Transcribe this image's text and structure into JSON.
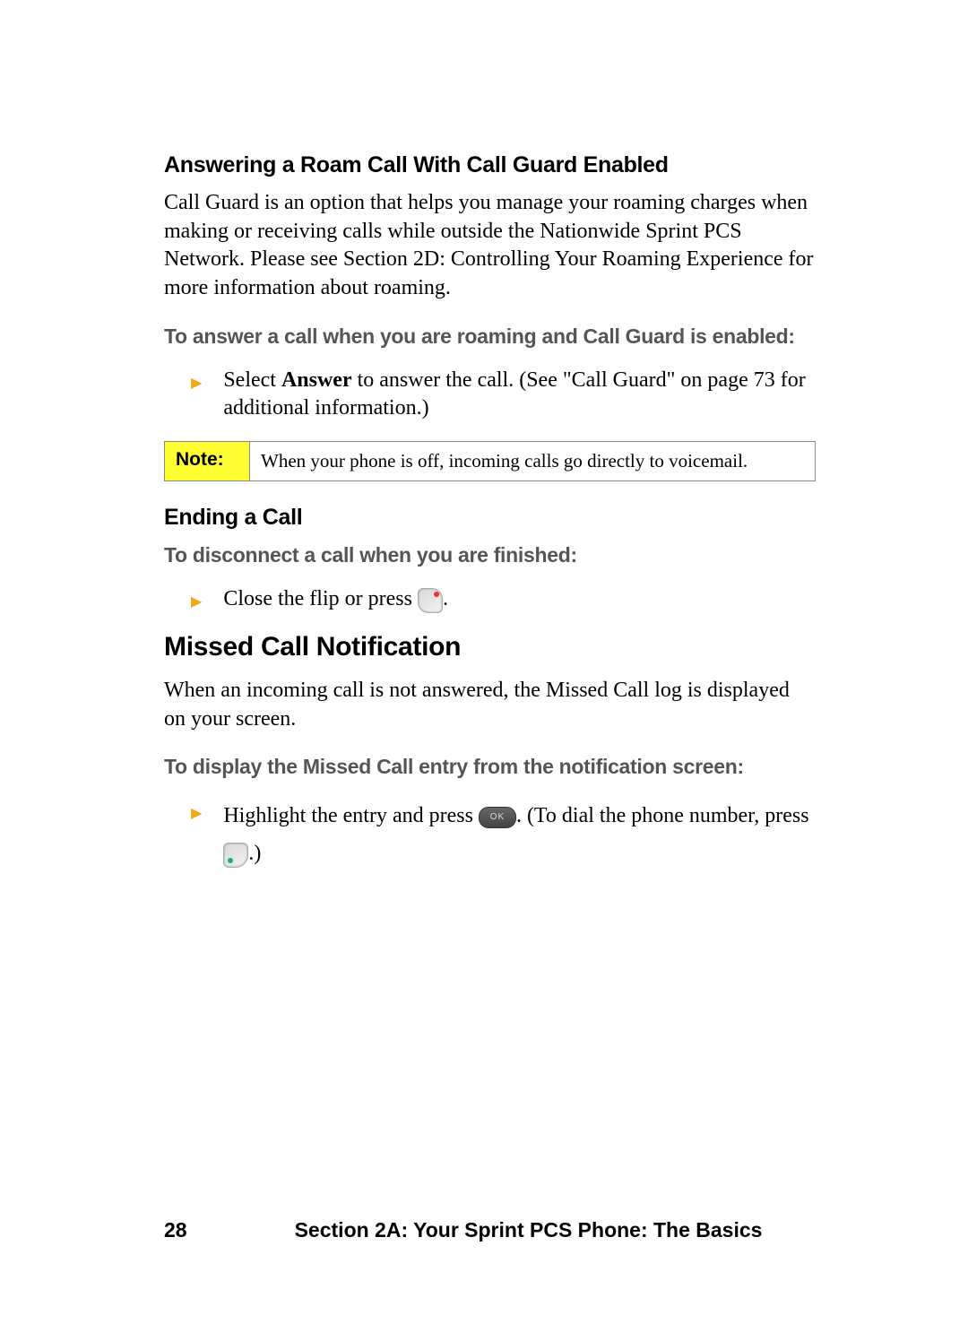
{
  "sections": {
    "roamCall": {
      "heading": "Answering a Roam Call With Call Guard Enabled",
      "body": "Call Guard is an option that helps you manage your roaming charges when making or receiving calls while outside the Nationwide Sprint PCS Network. Please see Section 2D: Controlling Your Roaming Experience for more information about roaming.",
      "lead": "To answer a call when you are roaming and Call Guard is enabled:",
      "bullet_pre": "Select ",
      "bullet_bold": "Answer",
      "bullet_post": " to answer the call. (See \"Call Guard\" on page 73 for additional information.)"
    },
    "note": {
      "label": "Note:",
      "text": "When your phone is off, incoming calls go directly to voicemail."
    },
    "endingCall": {
      "heading": "Ending a Call",
      "lead": "To disconnect a call when you are finished:",
      "bullet_pre": "Close the flip or press ",
      "bullet_post": "."
    },
    "missed": {
      "heading": "Missed Call Notification",
      "body": "When an incoming call is not answered, the Missed Call log is displayed on your screen.",
      "lead": "To display the Missed Call entry from the notification screen:",
      "bullet_pre": "Highlight the entry and press ",
      "bullet_mid": ". (To dial the phone number, press ",
      "bullet_post": ".)"
    }
  },
  "keys": {
    "ok_label": "OK"
  },
  "footer": {
    "page": "28",
    "section": "Section 2A: Your Sprint PCS Phone: The Basics"
  }
}
